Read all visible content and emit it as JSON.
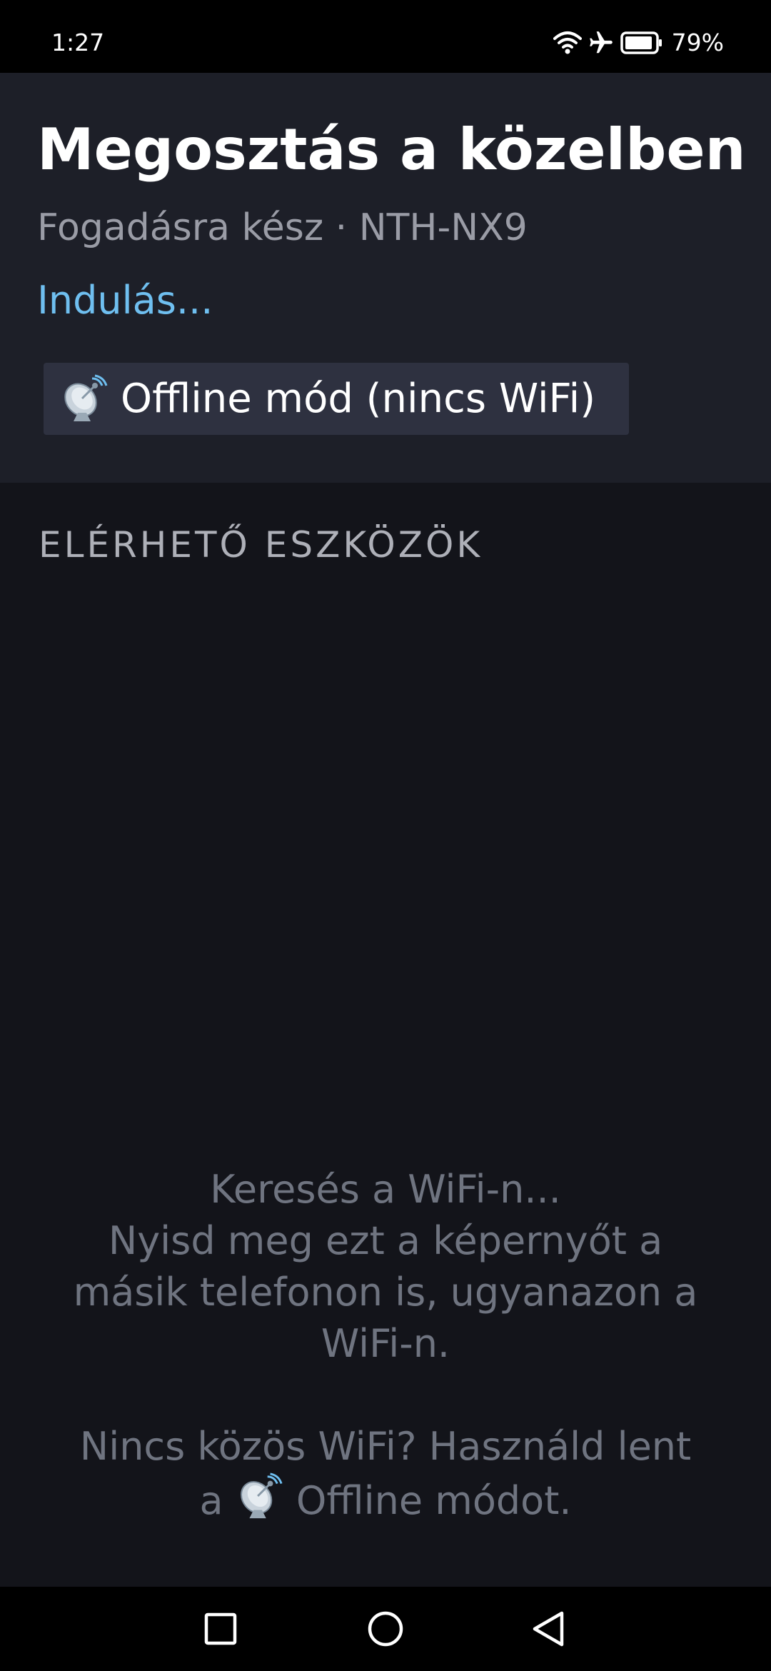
{
  "status_bar": {
    "time": "1:27",
    "battery_percent": "79%",
    "icons": [
      "wifi-icon",
      "airplane-mode-icon",
      "battery-icon"
    ]
  },
  "header": {
    "title": "Megosztás a közelben",
    "subtitle": "Fogadásra kész · NTH-NX9",
    "status": "Indulás...",
    "offline_button_label": "Offline mód (nincs WiFi)",
    "offline_button_icon": "satellite-dish-icon"
  },
  "devices_section": {
    "header": "ELÉRHETŐ ESZKÖZÖK"
  },
  "empty_state": {
    "line1": "Keresés a WiFi-n...",
    "line2": "Nyisd meg ezt a képernyőt a",
    "line3": "másik telefonon is, ugyanazon a",
    "line4": "WiFi-n.",
    "line5": "Nincs közös WiFi? Használd lent",
    "line6_prefix": "a",
    "line6_suffix": "Offline módot."
  },
  "nav_bar": {
    "buttons": [
      "recents-button",
      "home-button",
      "back-button"
    ]
  },
  "colors": {
    "status_bar_bg": "#000000",
    "header_bg": "#1d1f28",
    "body_bg": "#13141a",
    "accent": "#6fbff0",
    "button_bg": "#2e3140",
    "secondary_text": "#9a9ca6",
    "muted_text": "#6f7480"
  }
}
